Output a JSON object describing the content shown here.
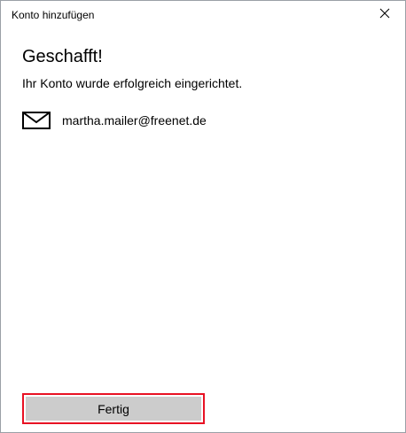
{
  "window": {
    "title": "Konto hinzufügen",
    "close_icon": "close-icon"
  },
  "content": {
    "heading": "Geschafft!",
    "message": "Ihr Konto wurde erfolgreich eingerichtet.",
    "account": {
      "icon": "mail-icon",
      "email": "martha.mailer@freenet.de"
    }
  },
  "footer": {
    "done_label": "Fertig"
  },
  "colors": {
    "highlight_border": "#e81123",
    "button_background": "#cccccc",
    "background": "#ffffff"
  }
}
